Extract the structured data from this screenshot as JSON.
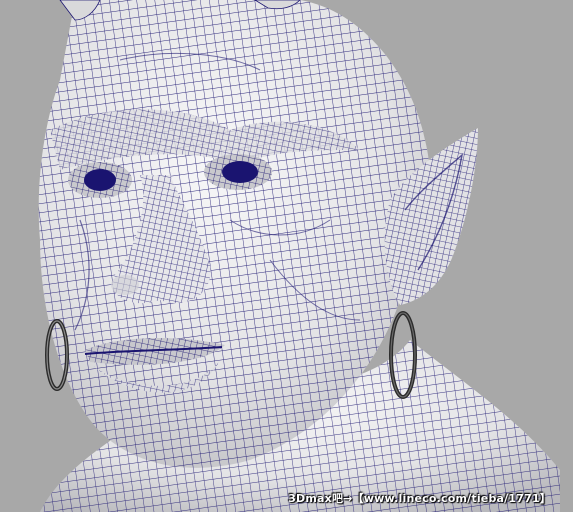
{
  "scene": {
    "subject": "ogre-head-wireframe-render",
    "background_color": "#a8a8a8",
    "skin_color": "#e9e9ea",
    "wire_color": "#1a1470",
    "eye_color": "#1a1470",
    "earring_color": "#2b2b2b"
  },
  "watermark": {
    "text": "3Dmax吧→【www.lineco.com/tieba/1771】"
  }
}
